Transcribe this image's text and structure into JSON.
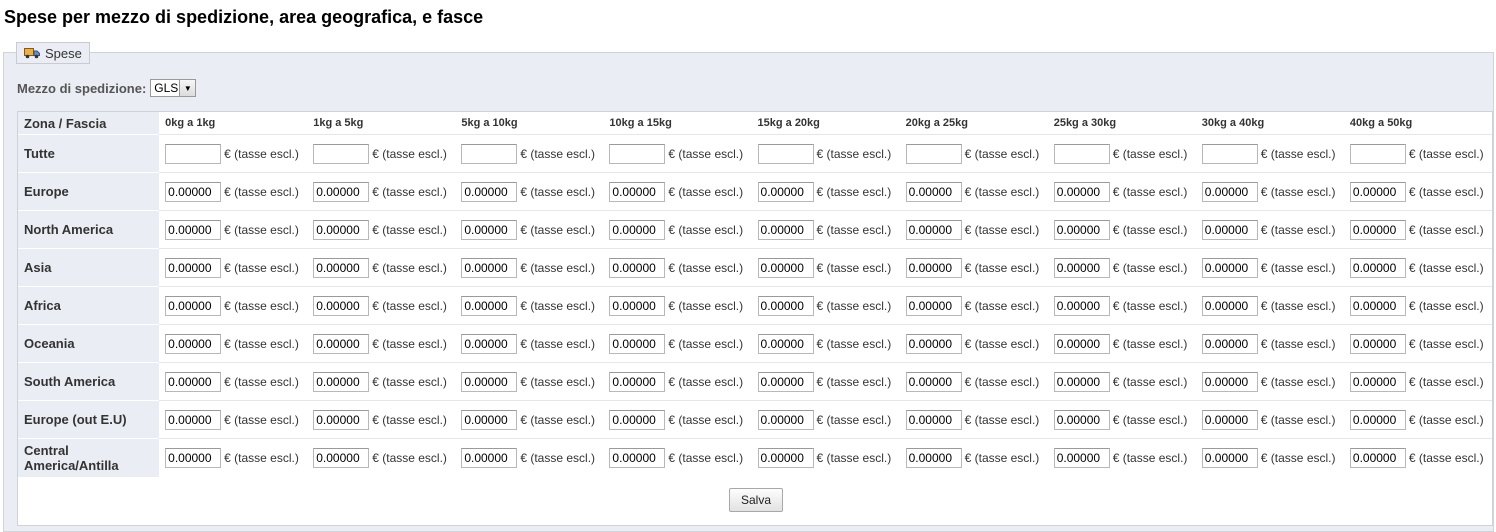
{
  "page_title": "Spese per mezzo di spedizione, area geografica, e fasce",
  "section_legend": "Spese",
  "legend_icon": "truck-icon",
  "carrier": {
    "label": "Mezzo di spedizione:",
    "selected": "GLS"
  },
  "table": {
    "zone_header": "Zona / Fascia",
    "unit_label": "€ (tasse escl.)",
    "ranges": [
      "0kg a 1kg",
      "1kg a 5kg",
      "5kg a 10kg",
      "10kg a 15kg",
      "15kg a 20kg",
      "20kg a 25kg",
      "25kg a 30kg",
      "30kg a 40kg",
      "40kg a 50kg"
    ],
    "rows": [
      {
        "zone": "Tutte",
        "values": [
          "",
          "",
          "",
          "",
          "",
          "",
          "",
          "",
          ""
        ]
      },
      {
        "zone": "Europe",
        "values": [
          "0.00000",
          "0.00000",
          "0.00000",
          "0.00000",
          "0.00000",
          "0.00000",
          "0.00000",
          "0.00000",
          "0.00000"
        ]
      },
      {
        "zone": "North America",
        "values": [
          "0.00000",
          "0.00000",
          "0.00000",
          "0.00000",
          "0.00000",
          "0.00000",
          "0.00000",
          "0.00000",
          "0.00000"
        ]
      },
      {
        "zone": "Asia",
        "values": [
          "0.00000",
          "0.00000",
          "0.00000",
          "0.00000",
          "0.00000",
          "0.00000",
          "0.00000",
          "0.00000",
          "0.00000"
        ]
      },
      {
        "zone": "Africa",
        "values": [
          "0.00000",
          "0.00000",
          "0.00000",
          "0.00000",
          "0.00000",
          "0.00000",
          "0.00000",
          "0.00000",
          "0.00000"
        ]
      },
      {
        "zone": "Oceania",
        "values": [
          "0.00000",
          "0.00000",
          "0.00000",
          "0.00000",
          "0.00000",
          "0.00000",
          "0.00000",
          "0.00000",
          "0.00000"
        ]
      },
      {
        "zone": "South America",
        "values": [
          "0.00000",
          "0.00000",
          "0.00000",
          "0.00000",
          "0.00000",
          "0.00000",
          "0.00000",
          "0.00000",
          "0.00000"
        ]
      },
      {
        "zone": "Europe (out E.U)",
        "values": [
          "0.00000",
          "0.00000",
          "0.00000",
          "0.00000",
          "0.00000",
          "0.00000",
          "0.00000",
          "0.00000",
          "0.00000"
        ]
      },
      {
        "zone": "Central America/Antilla",
        "values": [
          "0.00000",
          "0.00000",
          "0.00000",
          "0.00000",
          "0.00000",
          "0.00000",
          "0.00000",
          "0.00000",
          "0.00000"
        ]
      }
    ]
  },
  "save_label": "Salva"
}
